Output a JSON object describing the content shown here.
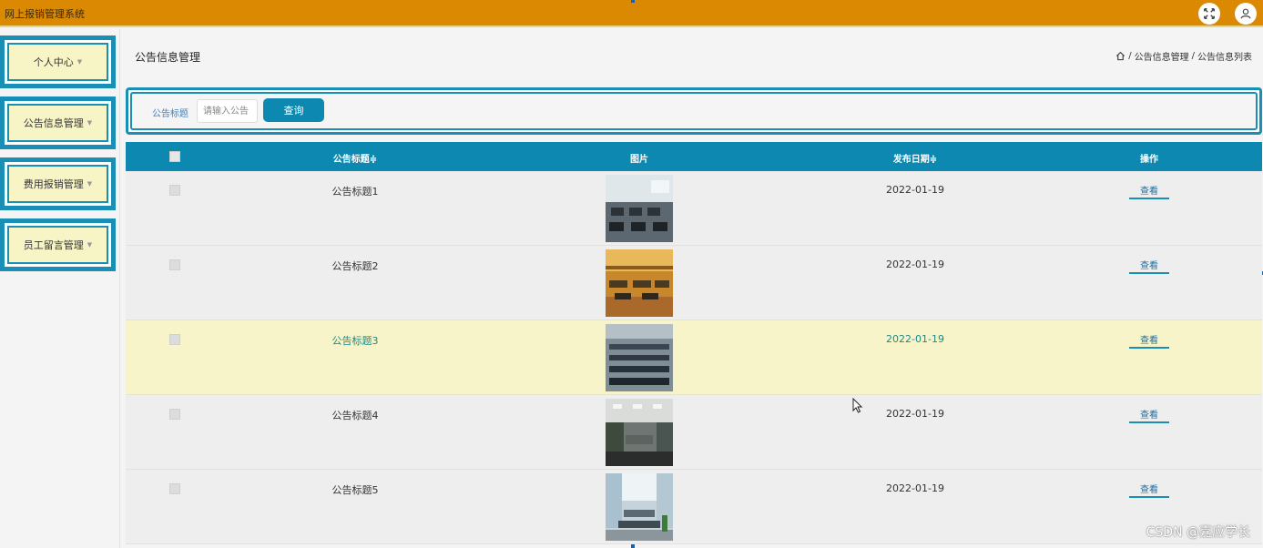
{
  "app": {
    "title": "网上报销管理系统"
  },
  "topbar": {
    "icons": [
      "fullscreen-icon",
      "user-icon"
    ]
  },
  "sidebar": {
    "items": [
      {
        "label": "个人中心"
      },
      {
        "label": "公告信息管理"
      },
      {
        "label": "费用报销管理"
      },
      {
        "label": "员工留言管理"
      }
    ]
  },
  "page": {
    "title": "公告信息管理",
    "breadcrumb": {
      "home_icon": "home-icon",
      "level1": "公告信息管理",
      "separator": "/",
      "level2": "公告信息列表"
    }
  },
  "search": {
    "label": "公告标题",
    "placeholder": "请输入公告",
    "value": "",
    "button": "查询"
  },
  "table": {
    "columns": {
      "title": "公告标题≑",
      "image": "图片",
      "date": "发布日期≑",
      "action": "操作"
    },
    "rows": [
      {
        "title": "公告标题1",
        "date": "2022-01-19",
        "action": "查看",
        "image": "office-photo-1"
      },
      {
        "title": "公告标题2",
        "date": "2022-01-19",
        "action": "查看",
        "image": "office-photo-2"
      },
      {
        "title": "公告标题3",
        "date": "2022-01-19",
        "action": "查看",
        "image": "office-photo-3"
      },
      {
        "title": "公告标题4",
        "date": "2022-01-19",
        "action": "查看",
        "image": "office-photo-4"
      },
      {
        "title": "公告标题5",
        "date": "2022-01-19",
        "action": "查看",
        "image": "office-photo-5"
      }
    ],
    "highlighted_row": 3
  },
  "watermark": "CSDN @嘉应学长",
  "colors": {
    "topbar": "#db8803",
    "accent": "#0d88b0",
    "menu_bg": "#f7f4c6",
    "highlight_row": "#f6f4c8"
  }
}
